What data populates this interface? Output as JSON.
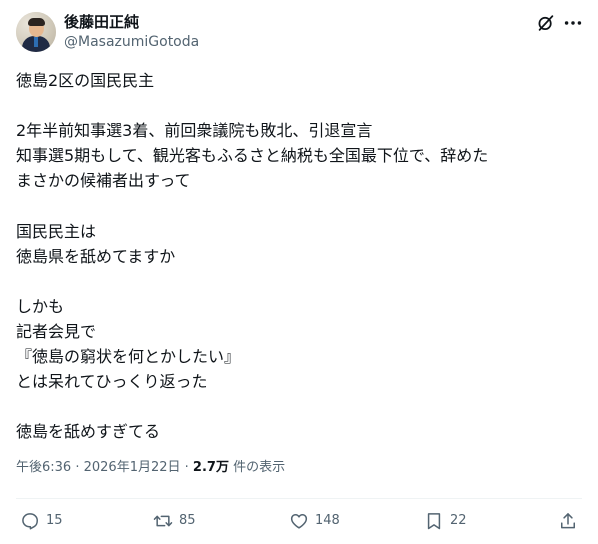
{
  "user": {
    "display_name": "後藤田正純",
    "handle": "@MasazumiGotoda"
  },
  "tweet": {
    "lines": [
      "徳島2区の国民民主",
      "",
      "2年半前知事選3着、前回衆議院も敗北、引退宣言",
      "知事選5期もして、観光客もふるさと納税も全国最下位で、辞めた",
      "まさかの候補者出すって",
      "",
      "国民民主は",
      "徳島県を舐めてますか",
      "",
      "しかも",
      "記者会見で",
      "『徳島の窮状を何とかしたい』",
      "とは呆れてひっくり返った",
      "",
      "徳島を舐めすぎてる"
    ]
  },
  "meta": {
    "time": "午後6:36",
    "separator": " · ",
    "date": "2026年1月22日",
    "views_count": "2.7万",
    "views_label": " 件の表示"
  },
  "actions": {
    "reply": {
      "icon": "reply-icon",
      "count": "15"
    },
    "repost": {
      "icon": "repost-icon",
      "count": "85"
    },
    "like": {
      "icon": "like-icon",
      "count": "148"
    },
    "bookmark": {
      "icon": "bookmark-icon",
      "count": "22"
    },
    "share": {
      "icon": "share-icon"
    }
  },
  "colors": {
    "text": "#0f1419",
    "secondary": "#536471",
    "divider": "#eff3f4"
  }
}
